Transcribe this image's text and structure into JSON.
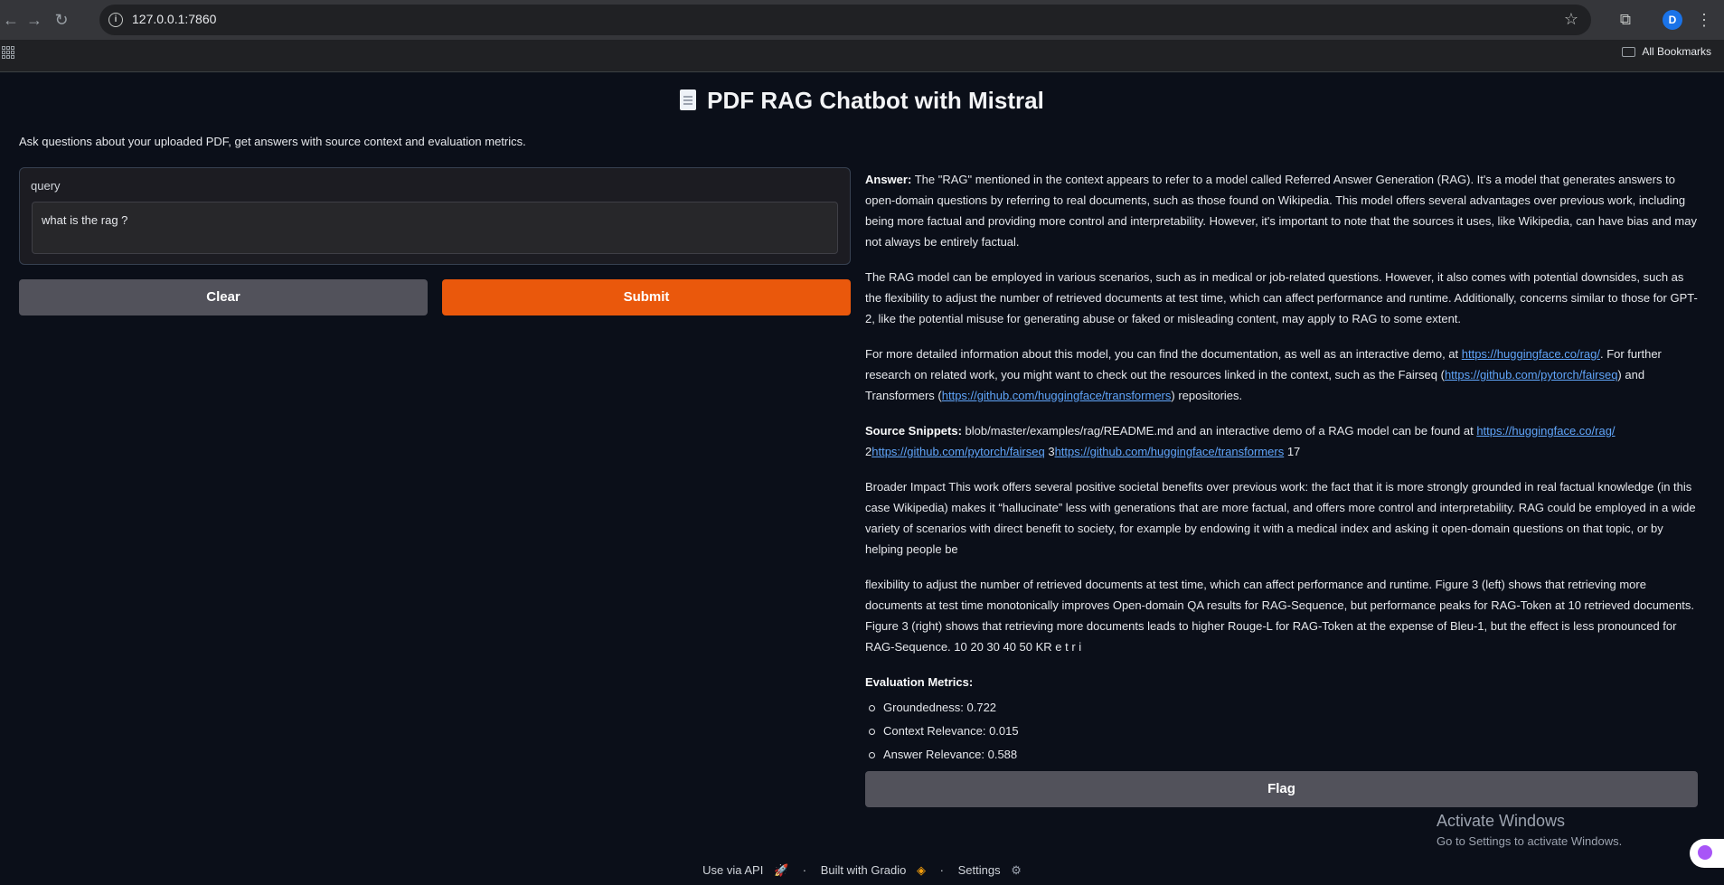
{
  "browser": {
    "url": "127.0.0.1:7860",
    "profile_initial": "D",
    "bookmarks_label": "All Bookmarks"
  },
  "app": {
    "title": "PDF RAG Chatbot with Mistral",
    "description": "Ask questions about your uploaded PDF, get answers with source context and evaluation metrics.",
    "query_label": "query",
    "query_value": "what is the rag ?",
    "clear_label": "Clear",
    "submit_label": "Submit",
    "flag_label": "Flag"
  },
  "output": {
    "answer_label": "Answer:",
    "answer_text": "The \"RAG\" mentioned in the context appears to refer to a model called Referred Answer Generation (RAG). It's a model that generates answers to open-domain questions by referring to real documents, such as those found on Wikipedia. This model offers several advantages over previous work, including being more factual and providing more control and interpretability. However, it's important to note that the sources it uses, like Wikipedia, can have bias and may not always be entirely factual.",
    "para2": "The RAG model can be employed in various scenarios, such as in medical or job-related questions. However, it also comes with potential downsides, such as the flexibility to adjust the number of retrieved documents at test time, which can affect performance and runtime. Additionally, concerns similar to those for GPT-2, like the potential misuse for generating abuse or faked or misleading content, may apply to RAG to some extent.",
    "para3_a": "For more detailed information about this model, you can find the documentation, as well as an interactive demo, at ",
    "link_rag": "https://huggingface.co/rag/",
    "para3_b": ". For further research on related work, you might want to check out the resources linked in the context, such as the Fairseq (",
    "link_fairseq": "https://github.com/pytorch/fairseq",
    "para3_c": ") and Transformers (",
    "link_transformers": "https://github.com/huggingface/transformers",
    "para3_d": ") repositories.",
    "snippets_label": "Source Snippets:",
    "snippets_a": " blob/master/examples/rag/README.md and an interactive demo of a RAG model can be found at ",
    "snippets_b": "2",
    "snippets_c": " 3",
    "snippets_d": " 17",
    "para5": "Broader Impact This work offers several positive societal benefits over previous work: the fact that it is more strongly grounded in real factual knowledge (in this case Wikipedia) makes it “hallucinate” less with generations that are more factual, and offers more control and interpretability. RAG could be employed in a wide variety of scenarios with direct benefit to society, for example by endowing it with a medical index and asking it open-domain questions on that topic, or by helping people be",
    "para6": "flexibility to adjust the number of retrieved documents at test time, which can affect performance and runtime. Figure 3 (left) shows that retrieving more documents at test time monotonically improves Open-domain QA results for RAG-Sequence, but performance peaks for RAG-Token at 10 retrieved documents. Figure 3 (right) shows that retrieving more documents leads to higher Rouge-L for RAG-Token at the expense of Bleu-1, but the effect is less pronounced for RAG-Sequence. 10 20 30 40 50 KR e t r i",
    "metrics_label": "Evaluation Metrics:",
    "metrics": [
      "Groundedness: 0.722",
      "Context Relevance: 0.015",
      "Answer Relevance: 0.588"
    ]
  },
  "watermark": {
    "line1": "Activate Windows",
    "line2": "Go to Settings to activate Windows."
  },
  "footer": {
    "api_label": "Use via API",
    "built_label": "Built with Gradio",
    "settings_label": "Settings",
    "separator": "·"
  },
  "colors": {
    "accent": "#ea580c",
    "background": "#0b0f19",
    "secondary_button": "#52525b",
    "link": "#60a5fa"
  }
}
